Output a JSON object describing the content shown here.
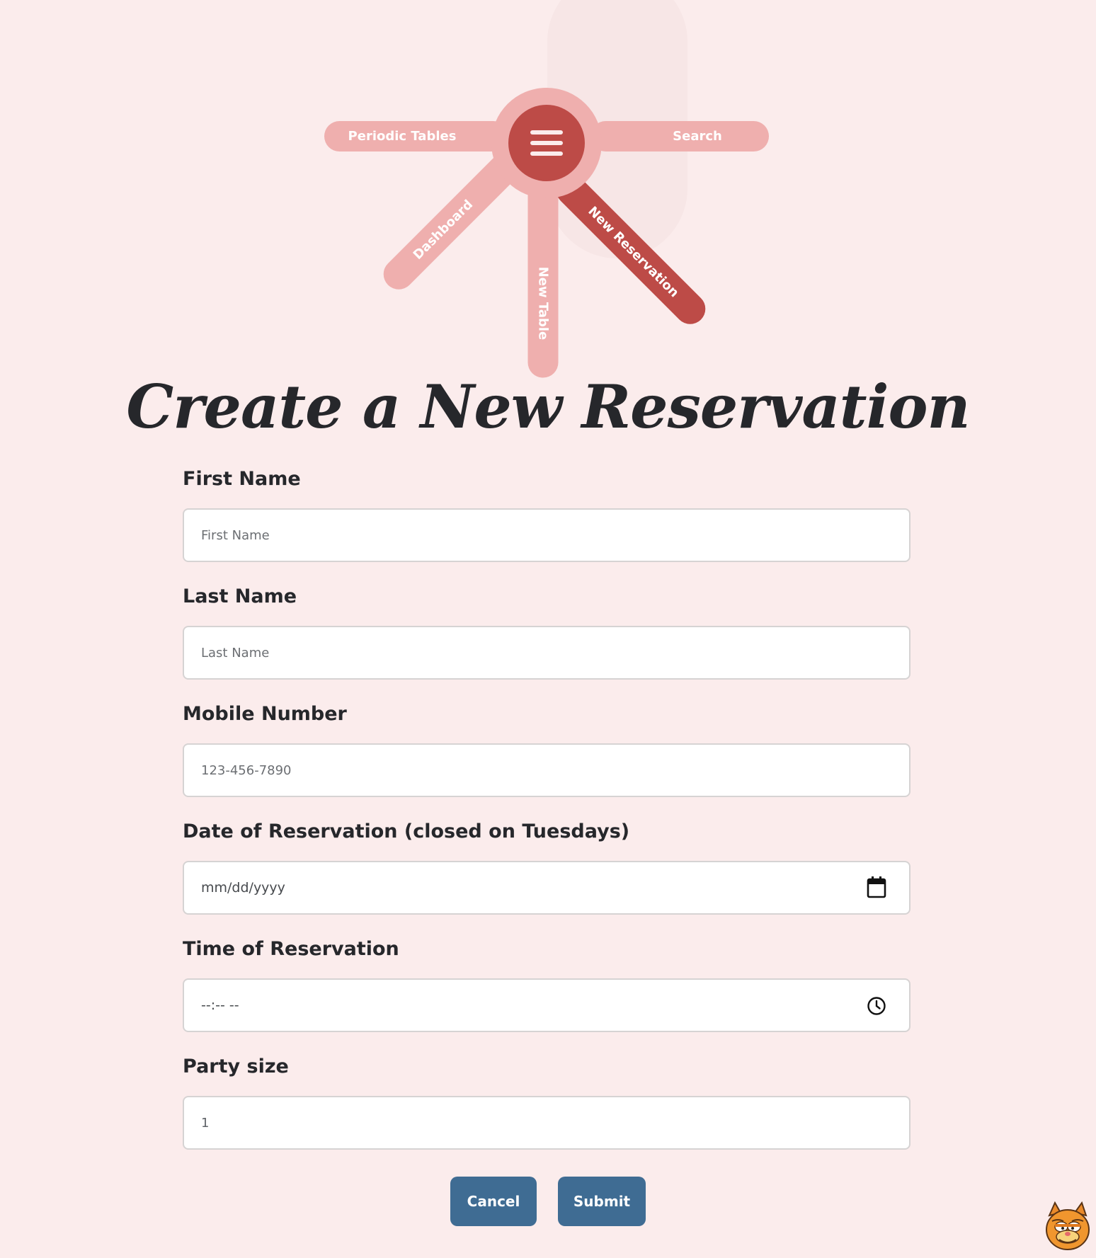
{
  "nav": {
    "menu_button_icon": "hamburger-icon",
    "items": [
      {
        "label": "Periodic Tables"
      },
      {
        "label": "Search"
      },
      {
        "label": "Dashboard"
      },
      {
        "label": "New Table"
      },
      {
        "label": "New Reservation",
        "active": true
      }
    ]
  },
  "page": {
    "title": "Create a New Reservation"
  },
  "form": {
    "first_name": {
      "label": "First Name",
      "placeholder": "First Name",
      "value": ""
    },
    "last_name": {
      "label": "Last Name",
      "placeholder": "Last Name",
      "value": ""
    },
    "mobile_number": {
      "label": "Mobile Number",
      "placeholder": "123-456-7890",
      "value": ""
    },
    "date": {
      "label": "Date of Reservation (closed on Tuesdays)",
      "display": "mm/dd/yyyy",
      "icon": "calendar-icon"
    },
    "time": {
      "label": "Time of Reservation",
      "display": "--:-- --",
      "icon": "clock-icon"
    },
    "party_size": {
      "label": "Party size",
      "value": "1"
    }
  },
  "buttons": {
    "cancel_label": "Cancel",
    "submit_label": "Submit"
  },
  "mascot": {
    "icon": "cartoon-cat-icon"
  },
  "colors": {
    "background": "#fbecec",
    "menu_light": "#efafae",
    "menu_active": "#bd4b47",
    "button": "#3f6c93",
    "text": "#26272b"
  }
}
